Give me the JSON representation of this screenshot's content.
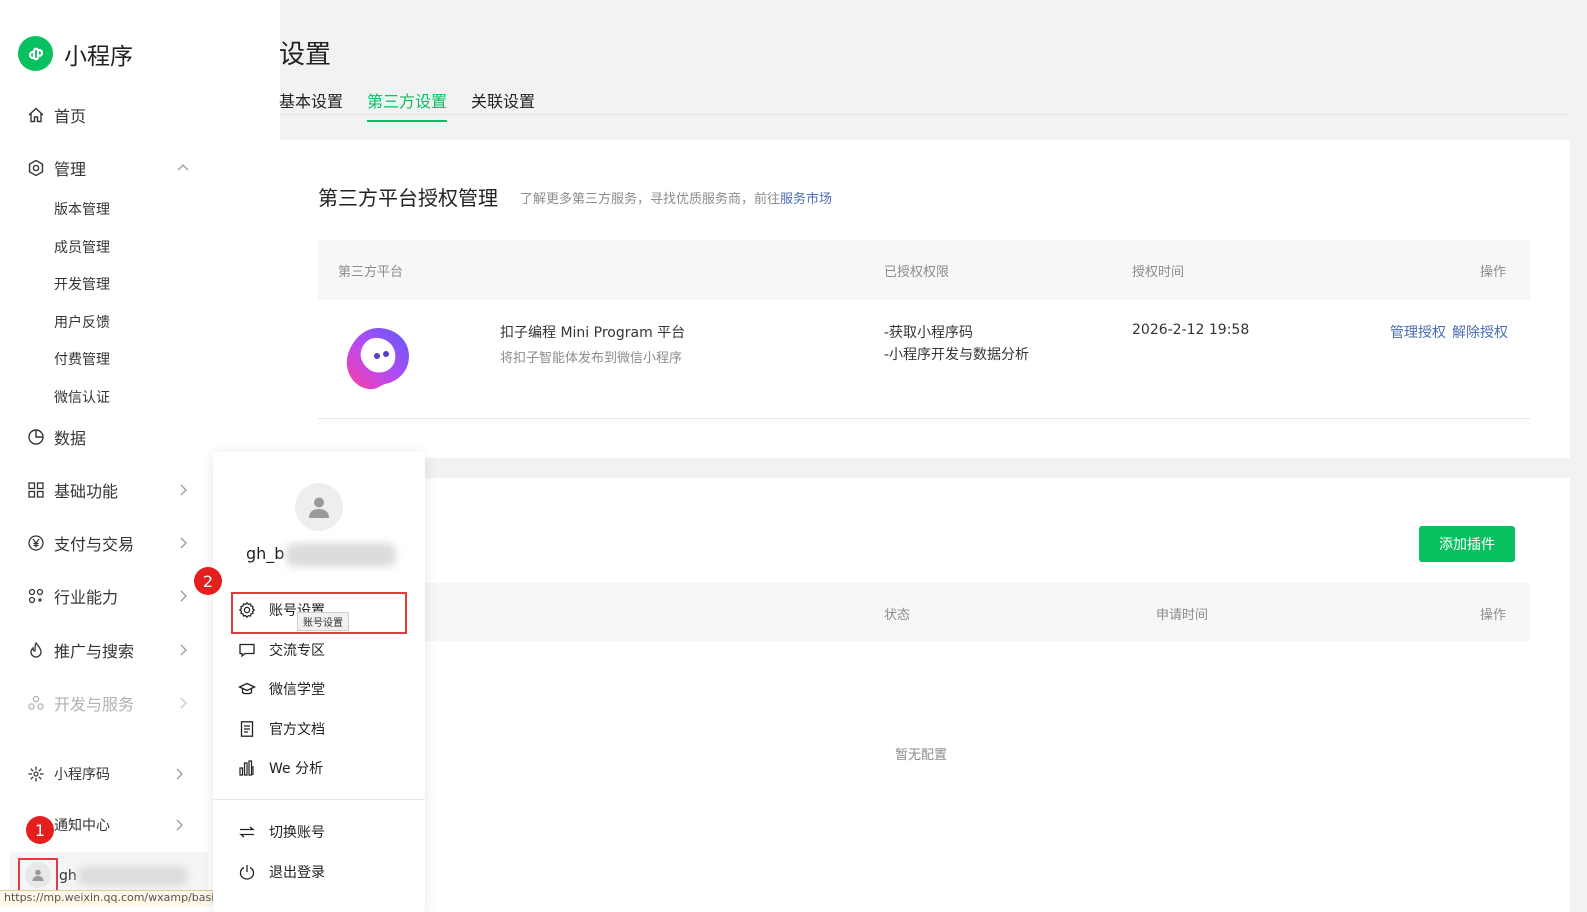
{
  "app": {
    "logo_text": "小程序",
    "accent": "#07c160"
  },
  "sidebar": {
    "home": "首页",
    "manage": "管理",
    "manage_items": [
      "版本管理",
      "成员管理",
      "开发管理",
      "用户反馈",
      "付费管理",
      "微信认证"
    ],
    "data": "数据",
    "basic": "基础功能",
    "pay": "支付与交易",
    "industry": "行业能力",
    "promo": "推广与搜索",
    "devservice": "开发与服务",
    "qrcode": "小程序码",
    "notify": "通知中心",
    "account_name": "gh"
  },
  "status_url": "https://mp.weixin.qq.com/wxamp/basicprofile/index?token=991698308&lang=zh_CN",
  "badges": {
    "one": "1",
    "two": "2"
  },
  "header": {
    "title": "设置",
    "tabs": [
      "基本设置",
      "第三方设置",
      "关联设置"
    ],
    "active_tab": "第三方设置"
  },
  "third_party": {
    "title": "第三方平台授权管理",
    "subtitle": "了解更多第三方服务，寻找优质服务商，前往",
    "market_link": "服务市场",
    "columns": [
      "第三方平台",
      "已授权权限",
      "授权时间",
      "操作"
    ],
    "row": {
      "name": "扣子编程 Mini Program 平台",
      "desc": "将扣子智能体发布到微信小程序",
      "perm1": "-获取小程序码",
      "perm2": "-小程序开发与数据分析",
      "time": "2026-2-12 19:58",
      "op_manage": "管理授权",
      "op_remove": "解除授权"
    }
  },
  "plugins": {
    "add_button": "添加插件",
    "columns": [
      "状态",
      "申请时间",
      "操作"
    ],
    "empty": "暂无配置"
  },
  "popover": {
    "name": "gh_b",
    "items": [
      "账号设置",
      "交流专区",
      "微信学堂",
      "官方文档",
      "We 分析"
    ],
    "items2": [
      "切换账号",
      "退出登录"
    ],
    "tooltip": "账号设置"
  }
}
